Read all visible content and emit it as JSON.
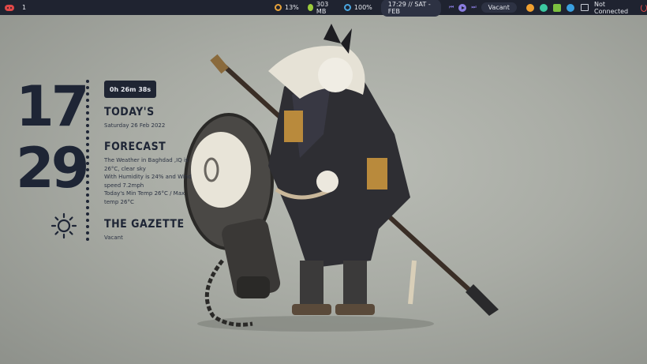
{
  "topbar": {
    "workspace": "1",
    "cpu": "13%",
    "memory": "303 MB",
    "disk": "100%",
    "datetime": "17:29 // SAT - FEB",
    "media_title": "Vacant",
    "network": "Not Connected",
    "colors": {
      "bar": "#1f2330",
      "pill": "#2d3243",
      "accent_red": "#e04848",
      "accent_purple": "#8a7de0"
    }
  },
  "clock": {
    "hours": "17",
    "minutes": "29"
  },
  "widget": {
    "uptime": "0h 26m 38s",
    "today": {
      "title": "TODAY'S",
      "date": "Saturday 26 Feb 2022"
    },
    "forecast": {
      "title": "FORECAST",
      "line1": "The Weather in Baghdad ,IQ  is",
      "line2": "26°C, clear sky",
      "line3": "With Humidity is 24% and Wind",
      "line4": "speed 7.2mph",
      "line5": "Today's Min Temp 26°C / Max",
      "line6": "temp 26°C"
    },
    "gazette": {
      "title": "THE GAZETTE",
      "text": "Vacant"
    }
  },
  "icons": [
    "gamepad-icon",
    "cpu-icon",
    "memory-icon",
    "disk-icon",
    "previous-icon",
    "play-icon",
    "next-icon",
    "palette-icon",
    "app-icon",
    "screenshot-icon",
    "settings-icon",
    "network-icon",
    "power-icon",
    "sun-icon"
  ]
}
